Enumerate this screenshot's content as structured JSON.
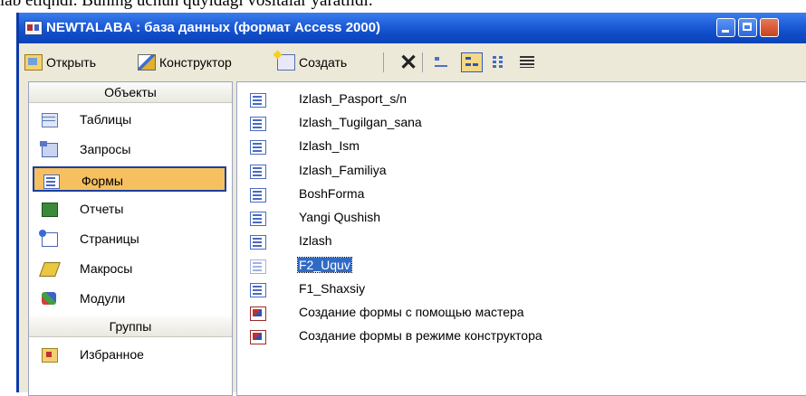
{
  "page": {
    "doc_text": "lab etiqndi. Buning uchun quyidagi vositalar yaratildi."
  },
  "window": {
    "title": "NEWTALABA : база данных (формат Access 2000)"
  },
  "toolbar": {
    "open_label": "Открыть",
    "design_label": "Конструктор",
    "new_label": "Создать"
  },
  "sidebar": {
    "objects_header": "Объекты",
    "items": [
      {
        "label": "Таблицы",
        "icon": "table-icon"
      },
      {
        "label": "Запросы",
        "icon": "query-icon"
      },
      {
        "label": "Формы",
        "icon": "form-icon",
        "selected": true
      },
      {
        "label": "Отчеты",
        "icon": "report-icon"
      },
      {
        "label": "Страницы",
        "icon": "page-icon"
      },
      {
        "label": "Макросы",
        "icon": "macro-icon"
      },
      {
        "label": "Модули",
        "icon": "module-icon"
      }
    ],
    "groups_header": "Группы",
    "groups": [
      {
        "label": "Избранное",
        "icon": "favorites-icon"
      }
    ]
  },
  "forms_list": [
    {
      "label": "Izlash_Pasport_s/n"
    },
    {
      "label": "Izlash_Tugilgan_sana"
    },
    {
      "label": "Izlash_Ism"
    },
    {
      "label": "Izlash_Familiya"
    },
    {
      "label": "BoshForma"
    },
    {
      "label": "Yangi Qushish"
    },
    {
      "label": "Izlash"
    },
    {
      "label": "F2_Uquv",
      "selected": true
    },
    {
      "label": "F1_Shaxsiy"
    },
    {
      "label": "Создание формы с помощью мастера"
    },
    {
      "label": "Создание формы в режиме конструктора"
    }
  ]
}
